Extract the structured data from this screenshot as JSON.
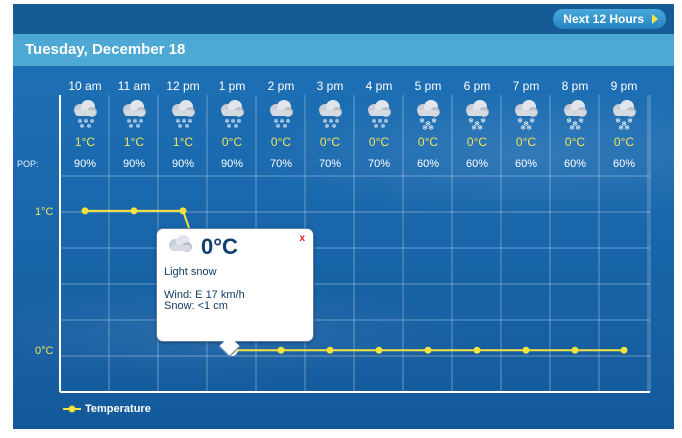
{
  "header": {
    "next_button_label": "Next 12 Hours"
  },
  "date_bar": {
    "title": "Tuesday, December 18"
  },
  "forecast": {
    "hours": [
      "10 am",
      "11 am",
      "12 pm",
      "1 pm",
      "2 pm",
      "3 pm",
      "4 pm",
      "5 pm",
      "6 pm",
      "7 pm",
      "8 pm",
      "9 pm"
    ],
    "temps": [
      "1°C",
      "1°C",
      "1°C",
      "0°C",
      "0°C",
      "0°C",
      "0°C",
      "0°C",
      "0°C",
      "0°C",
      "0°C",
      "0°C"
    ],
    "pop_label": "POP:",
    "pops": [
      "90%",
      "90%",
      "90%",
      "90%",
      "70%",
      "70%",
      "70%",
      "60%",
      "60%",
      "60%",
      "60%",
      "60%"
    ],
    "icons": [
      "snow-cloud-icon",
      "snow-cloud-icon",
      "snow-cloud-icon",
      "snow-cloud-icon",
      "snow-cloud-icon",
      "snow-cloud-icon",
      "snow-cloud-icon",
      "snowflake-cloud-icon",
      "snowflake-cloud-icon",
      "snowflake-cloud-icon",
      "snowflake-cloud-icon",
      "snowflake-cloud-icon"
    ]
  },
  "chart_data": {
    "type": "line",
    "x": [
      "10 am",
      "11 am",
      "12 pm",
      "1 pm",
      "2 pm",
      "3 pm",
      "4 pm",
      "5 pm",
      "6 pm",
      "7 pm",
      "8 pm",
      "9 pm"
    ],
    "series": [
      {
        "name": "Temperature",
        "values": [
          1,
          1,
          1,
          0,
          0,
          0,
          0,
          0,
          0,
          0,
          0,
          0
        ]
      }
    ],
    "yticks": [
      "1°C",
      "0°C"
    ],
    "ylim": [
      -0.3,
      1.25
    ],
    "line_color": "#f6e23c",
    "legend_position": "bottom-left",
    "grid": true
  },
  "popup": {
    "temp": "0°C",
    "close": "x",
    "condition": "Light snow",
    "wind": "Wind: E 17 km/h",
    "snow": "Snow: <1  cm"
  },
  "legend": {
    "label": "Temperature"
  }
}
